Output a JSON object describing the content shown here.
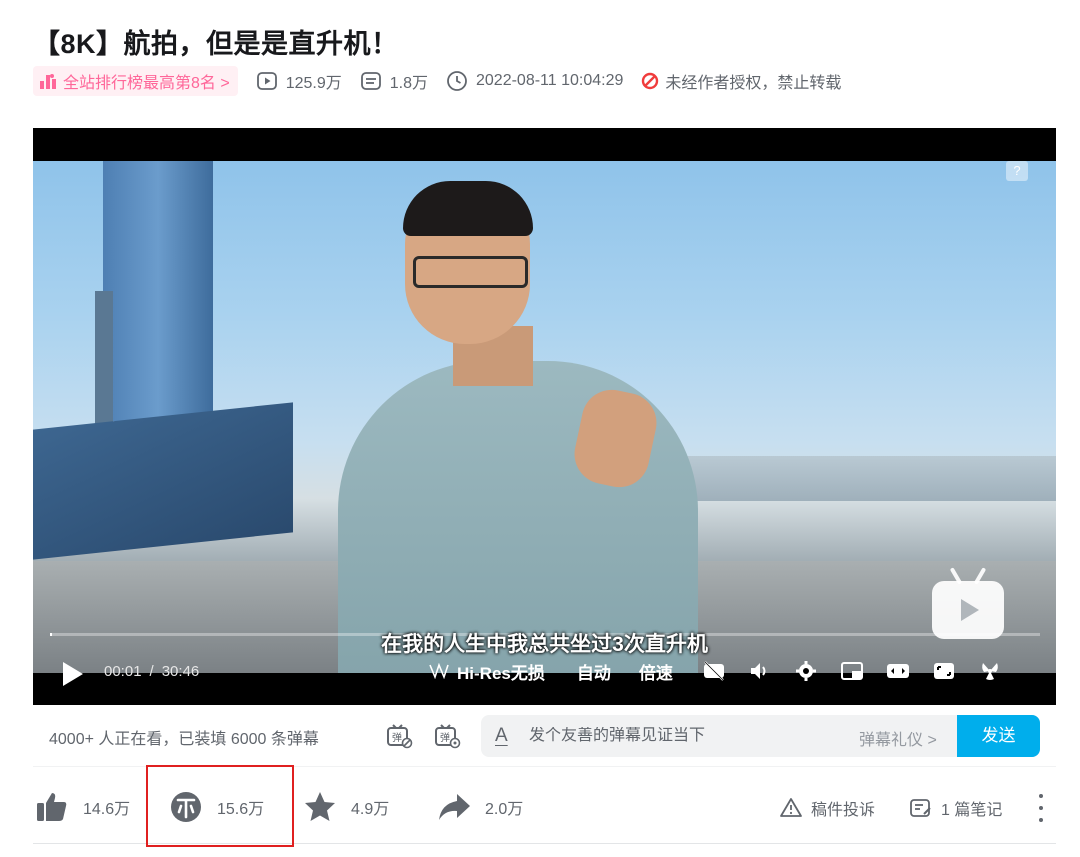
{
  "video": {
    "title": "【8K】航拍，但是是直升机！"
  },
  "meta": {
    "rank_badge": "全站排行榜最高第8名 >",
    "views": "125.9万",
    "danmaku_count": "1.8万",
    "publish_time": "2022-08-11 10:04:29",
    "copyright_notice": "未经作者授权，禁止转载"
  },
  "player": {
    "subtitle": "在我的人生中我总共坐过3次直升机",
    "current_time": "00:01",
    "time_separator": "/",
    "duration": "30:46",
    "progress_fraction": 0.0005,
    "hires_label": "Hi-Res无损",
    "auto_label": "自动",
    "speed_label": "倍速",
    "help_label": "?"
  },
  "danmaku": {
    "watching_text": "4000+ 人正在看，已装填 6000 条弹幕",
    "input_placeholder": "发个友善的弹幕见证当下",
    "format_icon_label": "A",
    "etiquette_label": "弹幕礼仪 >",
    "send_label": "发送"
  },
  "toolbar": {
    "like_count": "14.6万",
    "coin_count": "15.6万",
    "favorite_count": "4.9万",
    "share_count": "2.0万",
    "report_label": "稿件投诉",
    "notes_label": "1 篇笔记"
  },
  "colors": {
    "brand_pink": "#ff6699",
    "brand_blue": "#00aeec",
    "text_secondary": "#61666d",
    "highlight_red": "#e02020",
    "warning_red": "#f03c3c"
  }
}
